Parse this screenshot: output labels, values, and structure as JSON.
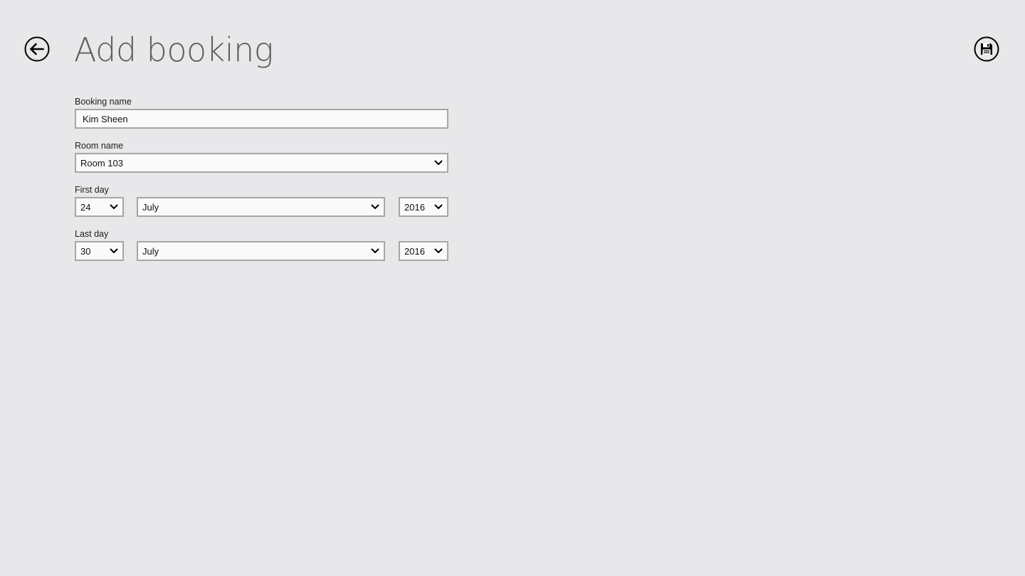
{
  "header": {
    "title": "Add booking",
    "back_icon": "back-arrow-circle-icon",
    "save_icon": "save-floppy-circle-icon"
  },
  "form": {
    "booking_name": {
      "label": "Booking name",
      "value": "Kim Sheen"
    },
    "room_name": {
      "label": "Room name",
      "value": "Room 103"
    },
    "first_day": {
      "label": "First day",
      "day": "24",
      "month": "July",
      "year": "2016"
    },
    "last_day": {
      "label": "Last day",
      "day": "30",
      "month": "July",
      "year": "2016"
    }
  },
  "colors": {
    "background": "#e8e8ea",
    "title": "#5e5e5e",
    "input_border": "#a6a6a6",
    "input_background": "#fafafa"
  }
}
